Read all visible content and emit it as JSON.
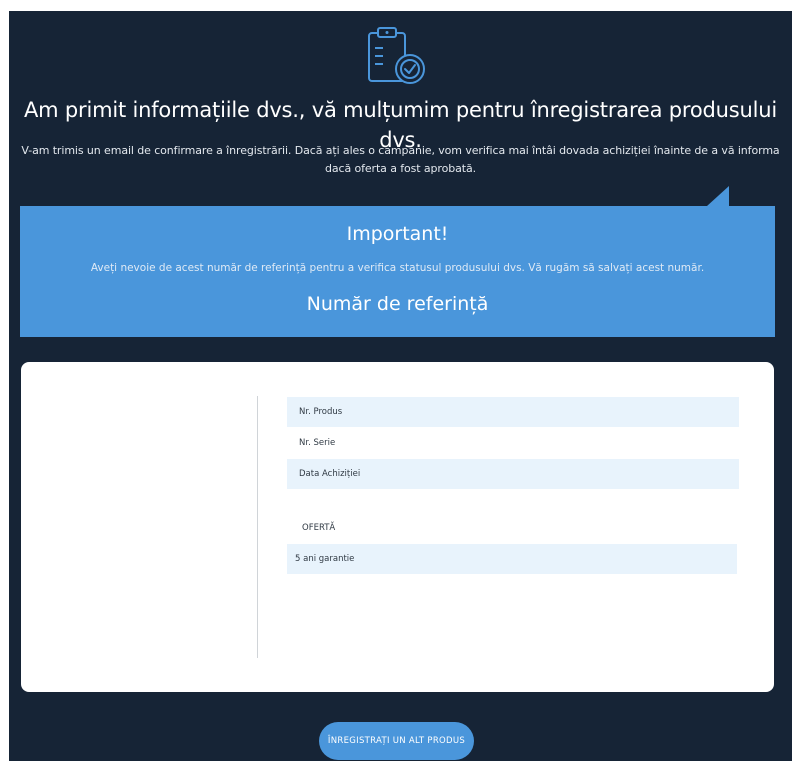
{
  "colors": {
    "page_background": "#162436",
    "accent": "#4a96db",
    "row_shade": "#e8f3fc"
  },
  "hero": {
    "icon": "clipboard-check-icon"
  },
  "headline": "Am primit informațiile dvs., vă mulțumim pentru înregistrarea produsului dvs.",
  "confirmation_text": "V-am trimis un email de confirmare a înregistrării. Dacă ați ales o campanie, vom verifica mai întâi dovada achiziției înainte de a vă informa dacă oferta a fost aprobată.",
  "important": {
    "title": "Important!",
    "text": "Aveți nevoie de acest număr de referință pentru a verifica statusul produsului dvs. Vă rugăm să salvați acest număr.",
    "reference_title": "Număr de referință"
  },
  "product_details": {
    "rows": [
      {
        "label": "Nr. Produs"
      },
      {
        "label": "Nr. Serie"
      },
      {
        "label": "Data Achiziției"
      }
    ],
    "offer_label": "OFERTĂ",
    "offer_value": "5 ani garantie"
  },
  "register_another_button": "ÎNREGISTRAȚI UN ALT PRODUS"
}
